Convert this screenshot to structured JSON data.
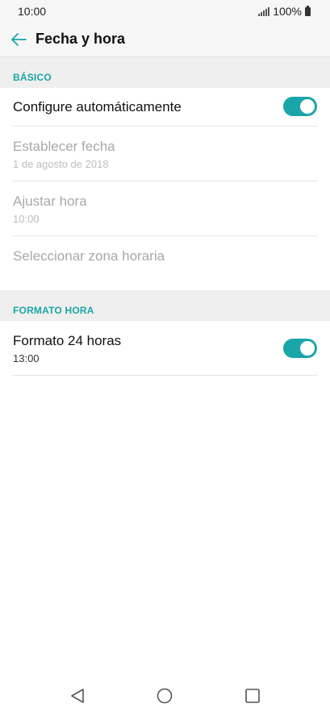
{
  "status_bar": {
    "time": "10:00",
    "battery": "100%",
    "icons": [
      "signal-icon",
      "battery-icon"
    ]
  },
  "header": {
    "title": "Fecha y hora",
    "back_icon": "arrow-left-icon"
  },
  "sections": [
    {
      "header": "BÁSICO",
      "items": [
        {
          "title": "Configure automáticamente",
          "toggle": true
        },
        {
          "title": "Establecer fecha",
          "subtitle": "1 de agosto de 2018",
          "disabled": true
        },
        {
          "title": "Ajustar hora",
          "subtitle": "10:00",
          "disabled": true
        },
        {
          "title": "Seleccionar zona horaria",
          "disabled": true
        }
      ]
    },
    {
      "header": "FORMATO HORA",
      "items": [
        {
          "title": "Formato 24 horas",
          "subtitle": "13:00",
          "toggle": true
        }
      ]
    }
  ],
  "nav_bar": {
    "icons": [
      "back-triangle-icon",
      "home-circle-icon",
      "recents-square-icon"
    ]
  },
  "colors": {
    "accent": "#1aa5a8",
    "section_bg": "#efefef",
    "disabled_text": "#a8a8a8"
  }
}
